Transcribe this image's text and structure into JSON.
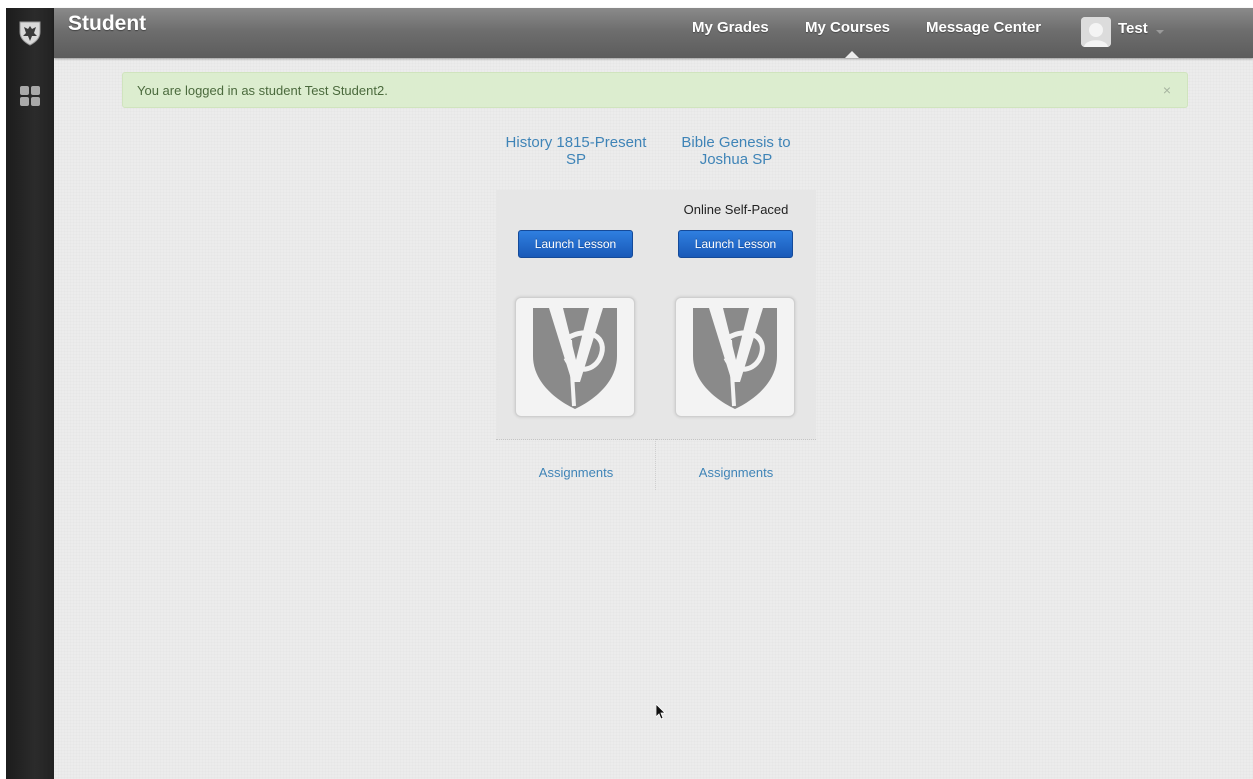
{
  "header": {
    "title": "Student",
    "nav": [
      "My Grades",
      "My Courses",
      "Message Center"
    ],
    "user": "Test"
  },
  "alert": {
    "text": "You are logged in as student Test Student2.",
    "close": "×"
  },
  "courses": [
    {
      "title": "History 1815-Present SP",
      "type": "",
      "launch": "Launch Lesson",
      "assignments": "Assignments"
    },
    {
      "title": "Bible Genesis to Joshua SP",
      "type": "Online Self-Paced",
      "launch": "Launch Lesson",
      "assignments": "Assignments"
    }
  ],
  "icons": {
    "rail_logo": "shield-logo-icon",
    "rail_apps": "apps-grid-icon",
    "avatar": "avatar-icon",
    "course_image": "vp-shield-icon"
  },
  "colors": {
    "link": "#3f84b7",
    "button": "#1e63c4",
    "alert_bg": "#dcedcf",
    "topbar": "#6e6e6e"
  }
}
